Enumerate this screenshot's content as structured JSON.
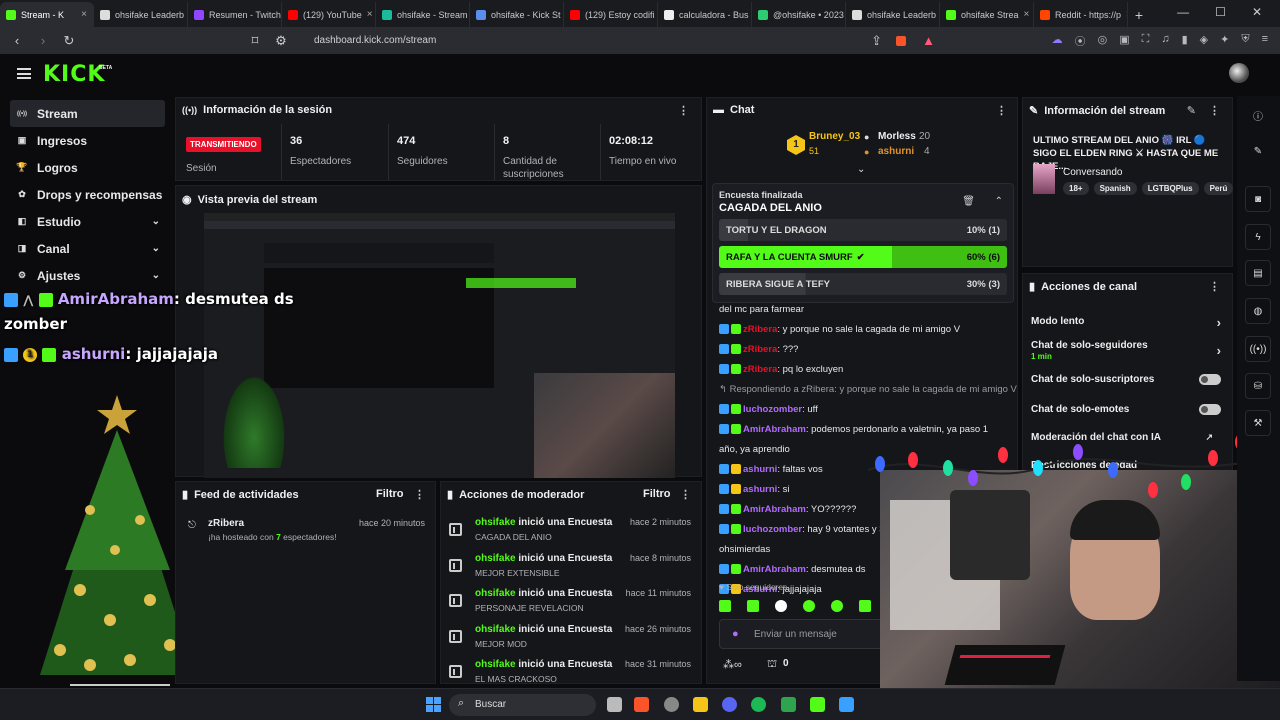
{
  "browser": {
    "tabs": [
      {
        "label": "Stream - K",
        "color": "#53fc18",
        "active": true
      },
      {
        "label": "ohsifake Leaderb",
        "color": "#dddddd"
      },
      {
        "label": "Resumen - Twitch",
        "color": "#9146ff"
      },
      {
        "label": "(129) YouTube",
        "color": "#ff0000"
      },
      {
        "label": "ohsifake - Stream",
        "color": "#1abc9c"
      },
      {
        "label": "ohsifake - Kick St",
        "color": "#5b8dee"
      },
      {
        "label": "(129) Estoy codifi",
        "color": "#ff0000"
      },
      {
        "label": "calculadora - Bus",
        "color": "#eeeeee"
      },
      {
        "label": "@ohsifake • 2023",
        "color": "#2ecc71"
      },
      {
        "label": "ohsifake Leaderb",
        "color": "#dddddd"
      },
      {
        "label": "ohsifake Strea",
        "color": "#53fc18"
      },
      {
        "label": "Reddit - https://p",
        "color": "#ff4500"
      }
    ],
    "new_tab": "+",
    "url": "dashboard.kick.com/stream"
  },
  "kick": {
    "logo": "KICK",
    "beta": "BETA"
  },
  "sidebar": {
    "items": [
      {
        "label": "Stream",
        "icon": "broadcast-icon"
      },
      {
        "label": "Ingresos",
        "icon": "wallet-icon"
      },
      {
        "label": "Logros",
        "icon": "trophy-icon"
      },
      {
        "label": "Drops y recompensas",
        "icon": "gift-icon"
      },
      {
        "label": "Estudio",
        "icon": "studio-icon"
      },
      {
        "label": "Canal",
        "icon": "channel-icon"
      },
      {
        "label": "Ajustes",
        "icon": "gear-icon"
      }
    ]
  },
  "session": {
    "title": "Información de la sesión",
    "status": "TRANSMITIENDO",
    "status_label": "Sesión",
    "viewers": "36",
    "viewers_label": "Espectadores",
    "followers": "474",
    "followers_label": "Seguidores",
    "subs": "8",
    "subs_label": "Cantidad de suscripciones",
    "uptime": "02:08:12",
    "uptime_label": "Tiempo en vivo"
  },
  "preview": {
    "title": "Vista previa del stream"
  },
  "overlay": {
    "line1_user": "AmirAbraham",
    "line1_msg": ": desmutea ds",
    "line1b": "zomber",
    "line2_user": "ashurni",
    "line2_msg": ": jajjajajaja"
  },
  "feed": {
    "title": "Feed de actividades",
    "filter": "Filtro",
    "user": "zRibera",
    "msg_pre": "¡ha hosteado con ",
    "count": "7",
    "msg_post": " espectadores!",
    "time": "hace 20 minutos"
  },
  "moderator": {
    "title": "Acciones de moderador",
    "filter": "Filtro",
    "rows": [
      {
        "user": "ohsifake",
        "action": " inició una Encuesta",
        "sub": "CAGADA DEL ANIO",
        "time": "hace 2 minutos"
      },
      {
        "user": "ohsifake",
        "action": " inició una Encuesta",
        "sub": "MEJOR EXTENSIBLE",
        "time": "hace 8 minutos"
      },
      {
        "user": "ohsifake",
        "action": " inició una Encuesta",
        "sub": "PERSONAJE REVELACION",
        "time": "hace 11 minutos"
      },
      {
        "user": "ohsifake",
        "action": " inició una Encuesta",
        "sub": "MEJOR MOD",
        "time": "hace 26 minutos"
      },
      {
        "user": "ohsifake",
        "action": " inició una Encuesta",
        "sub": "EL MAS CRACKOSO",
        "time": "hace 31 minutos"
      }
    ]
  },
  "chat": {
    "title": "Chat",
    "leader": {
      "rank": "1",
      "user": "Bruney_03",
      "count": "51"
    },
    "second": {
      "user": "Morless",
      "count": "20"
    },
    "third": {
      "user": "ashurni",
      "count": "4"
    },
    "poll": {
      "status": "Encuesta finalizada",
      "question": "CAGADA DEL ANIO",
      "options": [
        {
          "label": "TORTU Y EL DRAGON",
          "result": "10% (1)",
          "fraction": 0.1,
          "winner": false
        },
        {
          "label": "RAFA Y LA CUENTA SMURF",
          "result": "60% (6)",
          "fraction": 0.6,
          "winner": true
        },
        {
          "label": "RIBERA SIGUE A TEFY",
          "result": "30% (3)",
          "fraction": 0.3,
          "winner": false
        }
      ]
    },
    "messages": [
      {
        "user": "",
        "text": "del mc para farmear",
        "color": "#e8e8ea"
      },
      {
        "user": "zRibera",
        "text": ": y porque no sale la cagada de mi amigo V",
        "color": "#e9102a"
      },
      {
        "user": "zRibera",
        "text": ": ???",
        "color": "#e9102a"
      },
      {
        "user": "zRibera",
        "text": ": pq lo excluyen",
        "color": "#e9102a"
      },
      {
        "user": "",
        "text": "↰ Respondiendo a zRibera: y porque no sale la cagada de mi amigo V",
        "color": "#9a9aa2"
      },
      {
        "user": "luchozomber",
        "text": ": uff",
        "color": "#b26bff"
      },
      {
        "user": "AmirAbraham",
        "text": ": podemos perdonarlo a valetnin, ya paso 1",
        "color": "#b26bff"
      },
      {
        "user": "",
        "text": "año, ya aprendio",
        "color": "#e8e8ea"
      },
      {
        "user": "ashurni",
        "text": ": faltas vos",
        "color": "#b26bff"
      },
      {
        "user": "ashurni",
        "text": ": si",
        "color": "#b26bff"
      },
      {
        "user": "AmirAbraham",
        "text": ": YO??????",
        "color": "#b26bff"
      },
      {
        "user": "luchozomber",
        "text": ": hay 9 votantes y 35 v",
        "color": "#b26bff"
      },
      {
        "user": "",
        "text": "ohsimierdas",
        "color": "#e8e8ea"
      },
      {
        "user": "AmirAbraham",
        "text": ": desmutea ds",
        "color": "#b26bff"
      },
      {
        "user": "ashurni",
        "text": ": jajjajajaja",
        "color": "#b26bff"
      }
    ],
    "followers_only": "Solo seguidores",
    "input_placeholder": "Enviar un mensaje",
    "points": "0"
  },
  "stream_info": {
    "title": "Información del stream",
    "stream_title": "ULTIMO STREAM DEL ANIO 🎆 IRL 🔵 SIGO EL ELDEN RING ⚔ HASTA QUE ME BAJE...",
    "category": "Conversando",
    "tags": [
      "18+",
      "Spanish",
      "LGTBQPlus",
      "Perú"
    ]
  },
  "channel_actions": {
    "title": "Acciones de canal",
    "rows": [
      {
        "label": "Modo lento",
        "sub": "",
        "control": "chevron"
      },
      {
        "label": "Chat de solo-seguidores",
        "sub": "1 min",
        "control": "chevron"
      },
      {
        "label": "Chat de solo-suscriptores",
        "sub": "",
        "control": "toggle"
      },
      {
        "label": "Chat de solo-emotes",
        "sub": "",
        "control": "toggle"
      },
      {
        "label": "Moderación del chat con IA",
        "sub": "",
        "control": "link"
      },
      {
        "label": "Restricciones de edad",
        "sub": "",
        "control": "none"
      }
    ]
  },
  "taskbar": {
    "search": "Buscar"
  }
}
